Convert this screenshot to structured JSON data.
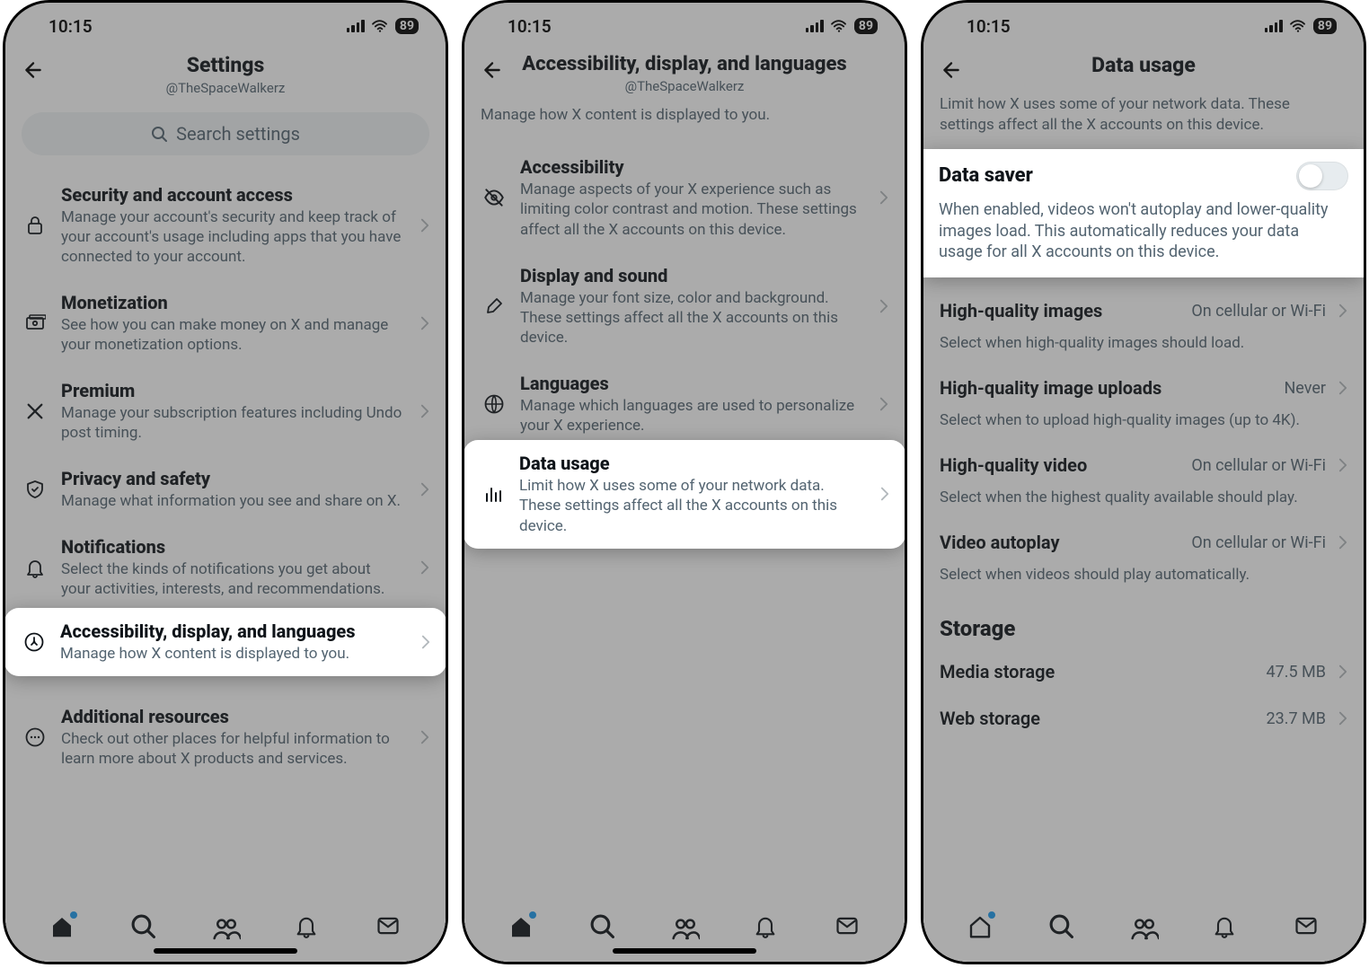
{
  "status": {
    "time": "10:15",
    "battery": "89"
  },
  "screen1": {
    "title": "Settings",
    "handle": "@TheSpaceWalkerz",
    "search_placeholder": "Search settings",
    "items": [
      {
        "title": "Security and account access",
        "sub": "Manage your account's security and keep track of your account's usage including apps that you have connected to your account."
      },
      {
        "title": "Monetization",
        "sub": "See how you can make money on X and manage your monetization options."
      },
      {
        "title": "Premium",
        "sub": "Manage your subscription features including Undo post timing."
      },
      {
        "title": "Privacy and safety",
        "sub": "Manage what information you see and share on X."
      },
      {
        "title": "Notifications",
        "sub": "Select the kinds of notifications you get about your activities, interests, and recommendations."
      },
      {
        "title": "Accessibility, display, and languages",
        "sub": "Manage how X content is displayed to you."
      },
      {
        "title": "Additional resources",
        "sub": "Check out other places for helpful information to learn more about X products and services."
      }
    ]
  },
  "screen2": {
    "title": "Accessibility, display, and languages",
    "handle": "@TheSpaceWalkerz",
    "desc": "Manage how X content is displayed to you.",
    "items": [
      {
        "title": "Accessibility",
        "sub": "Manage aspects of your X experience such as limiting color contrast and motion. These settings affect all the X accounts on this device."
      },
      {
        "title": "Display and sound",
        "sub": "Manage your font size, color and background. These settings affect all the X accounts on this device."
      },
      {
        "title": "Languages",
        "sub": "Manage which languages are used to personalize your X experience."
      },
      {
        "title": "Data usage",
        "sub": "Limit how X uses some of your network data. These settings affect all the X accounts on this device."
      }
    ]
  },
  "screen3": {
    "title": "Data usage",
    "desc": "Limit how X uses some of your network data. These settings affect all the X accounts on this device.",
    "data_saver": {
      "title": "Data saver",
      "sub": "When enabled, videos won't autoplay and lower-quality images load. This automatically reduces your data usage for all X accounts on this device."
    },
    "rows": [
      {
        "label": "High-quality images",
        "value": "On cellular or Wi-Fi",
        "helper": "Select when high-quality images should load."
      },
      {
        "label": "High-quality image uploads",
        "value": "Never",
        "helper": "Select when to upload high-quality images (up to 4K)."
      },
      {
        "label": "High-quality video",
        "value": "On cellular or Wi-Fi",
        "helper": "Select when the highest quality available should play."
      },
      {
        "label": "Video autoplay",
        "value": "On cellular or Wi-Fi",
        "helper": "Select when videos should play automatically."
      }
    ],
    "storage_header": "Storage",
    "storage": [
      {
        "label": "Media storage",
        "value": "47.5 MB"
      },
      {
        "label": "Web storage",
        "value": "23.7 MB"
      }
    ]
  }
}
